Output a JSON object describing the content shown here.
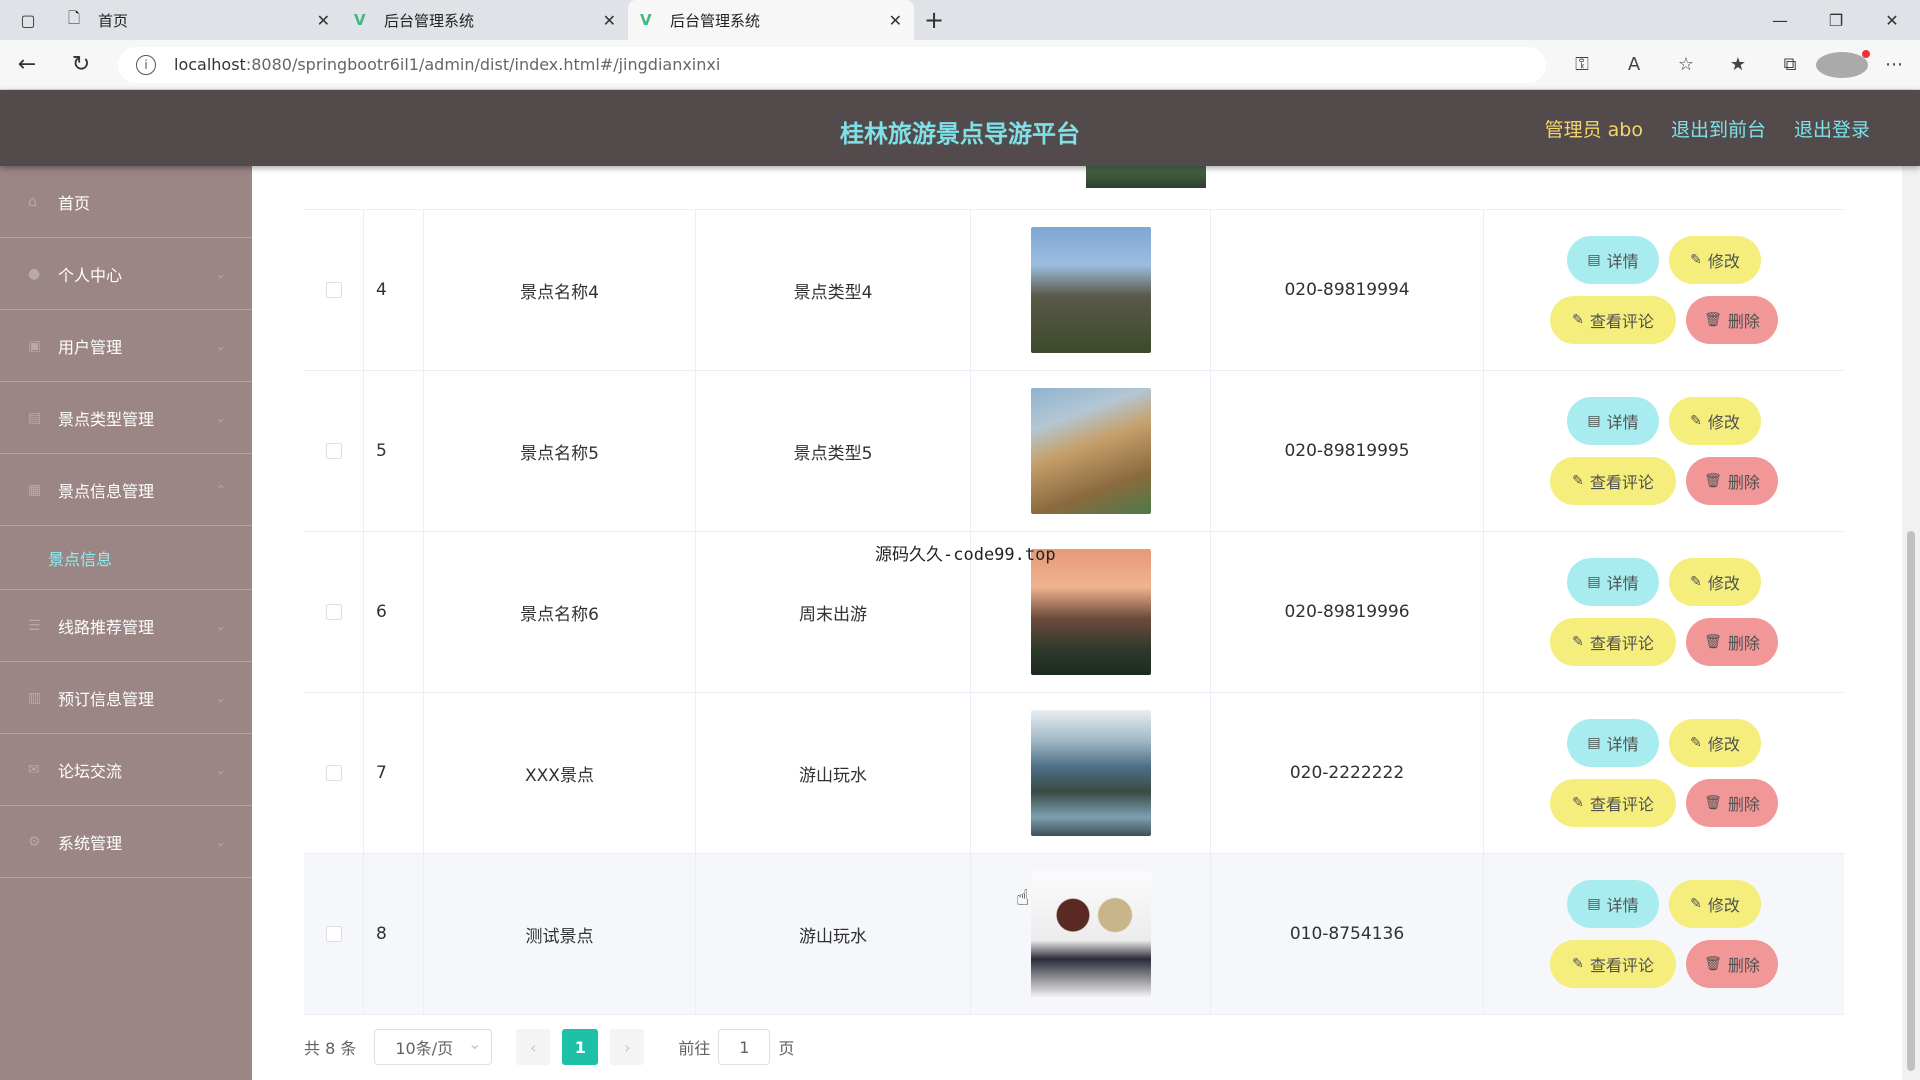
{
  "browser": {
    "tabs": [
      {
        "title": "首页",
        "active": false
      },
      {
        "title": "后台管理系统",
        "active": false
      },
      {
        "title": "后台管理系统",
        "active": true
      }
    ],
    "url_host": "localhost",
    "url_rest": ":8080/springbootr6il1/admin/dist/index.html#/jingdianxinxi"
  },
  "header": {
    "title": "桂林旅游景点导游平台",
    "admin_label": "管理员 abo",
    "exit_front": "退出到前台",
    "logout": "退出登录"
  },
  "sidebar": {
    "items": [
      {
        "label": "首页"
      },
      {
        "label": "个人中心"
      },
      {
        "label": "用户管理"
      },
      {
        "label": "景点类型管理"
      },
      {
        "label": "景点信息管理"
      }
    ],
    "sub_item": "景点信息",
    "items_after": [
      {
        "label": "线路推荐管理"
      },
      {
        "label": "预订信息管理"
      },
      {
        "label": "论坛交流"
      },
      {
        "label": "系统管理"
      }
    ]
  },
  "rows": [
    {
      "index": "4",
      "name": "景点名称4",
      "type": "景点类型4",
      "phone": "020-89819994"
    },
    {
      "index": "5",
      "name": "景点名称5",
      "type": "景点类型5",
      "phone": "020-89819995"
    },
    {
      "index": "6",
      "name": "景点名称6",
      "type": "周末出游",
      "phone": "020-89819996"
    },
    {
      "index": "7",
      "name": "XXX景点",
      "type": "游山玩水",
      "phone": "020-2222222"
    },
    {
      "index": "8",
      "name": "测试景点",
      "type": "游山玩水",
      "phone": "010-8754136"
    }
  ],
  "ops": {
    "detail": "详情",
    "edit": "修改",
    "comment": "查看评论",
    "delete": "删除"
  },
  "pager": {
    "total": "共 8 条",
    "page_size": "10条/页",
    "current": "1",
    "goto_prefix": "前往",
    "goto_value": "1",
    "goto_suffix": "页"
  },
  "overlay_text": "源码久久-code99.top"
}
